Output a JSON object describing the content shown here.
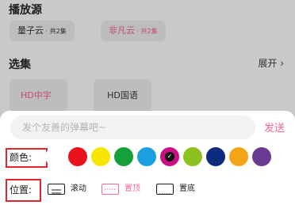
{
  "background": {
    "source_title": "播放源",
    "sources": [
      {
        "name": "量子云",
        "count": " · 共2集",
        "color": "#2a2a2a"
      },
      {
        "name": "非凡云",
        "count": " · 共2集",
        "color": "#c44a6a"
      }
    ],
    "episodes_title": "选集",
    "expand_label": "展开 ›",
    "episodes": [
      {
        "label": "HD中字",
        "active": true
      },
      {
        "label": "HD国语",
        "active": false
      }
    ]
  },
  "danmaku": {
    "placeholder": "发个友善的弹幕吧~",
    "send_label": "发送",
    "color_label": "颜色:",
    "colors": [
      "#ffffff",
      "#e8131d",
      "#f7e600",
      "#16a03a",
      "#1aa0e0",
      "#cc0f83",
      "#8cc11f",
      "#0c2b7e",
      "#f4a418",
      "#6a3a92"
    ],
    "selected_color": "#cc0f83",
    "position_label": "位置:",
    "positions": [
      {
        "label": "滚动",
        "icon": "scroll-position-icon",
        "color": "#1d1d1d",
        "selected": false
      },
      {
        "label": "置顶",
        "icon": "top-position-icon",
        "color": "#f0679a",
        "selected": true
      },
      {
        "label": "置底",
        "icon": "bottom-position-icon",
        "color": "#1d1d1d",
        "selected": false
      }
    ]
  }
}
